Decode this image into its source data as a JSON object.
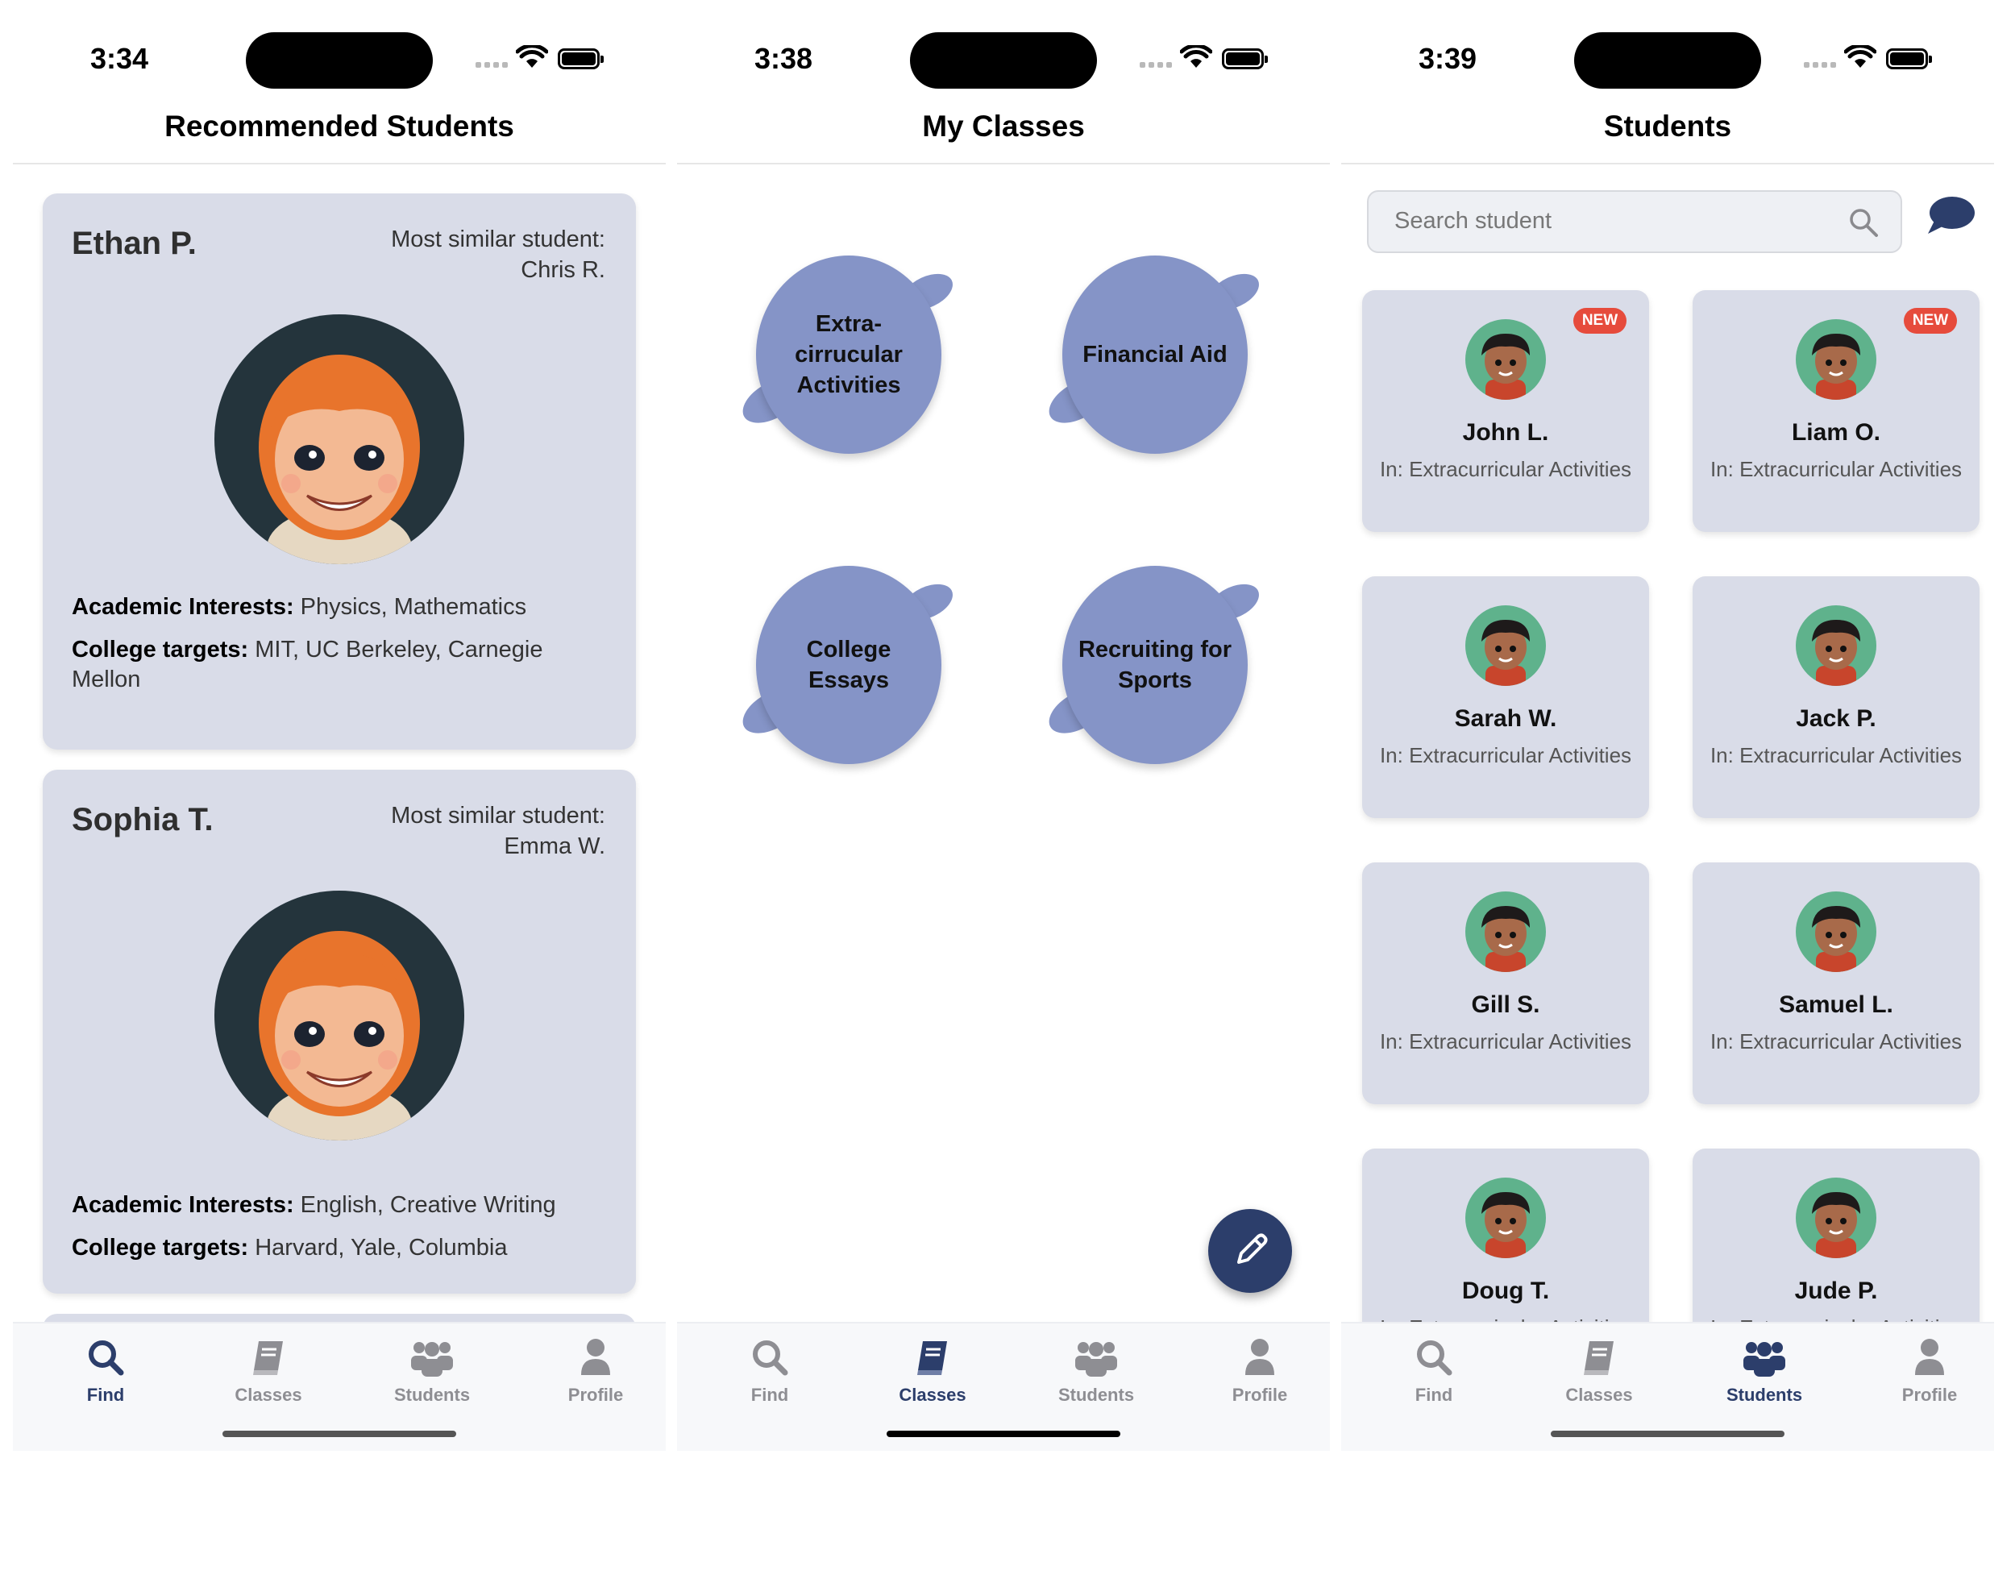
{
  "screens": {
    "find": {
      "time": "3:34",
      "title": "Recommended Students",
      "cards": [
        {
          "name": "Ethan P.",
          "similar_label": "Most similar student:",
          "similar_name": "Chris R.",
          "interests_label": "Academic Interests:",
          "interests": " Physics, Mathematics",
          "targets_label": "College targets:",
          "targets": " MIT, UC Berkeley, Carnegie Mellon"
        },
        {
          "name": "Sophia T.",
          "similar_label": "Most similar student:",
          "similar_name": "Emma W.",
          "interests_label": "Academic Interests:",
          "interests": " English, Creative Writing",
          "targets_label": "College targets:",
          "targets": " Harvard, Yale, Columbia"
        }
      ]
    },
    "classes": {
      "time": "3:38",
      "title": "My Classes",
      "bubbles": [
        "Extra-cirrucular Activities",
        "Financial Aid",
        "College Essays",
        "Recruiting for Sports"
      ]
    },
    "students": {
      "time": "3:39",
      "title": "Students",
      "search_placeholder": "Search student",
      "badge": "NEW",
      "cards": [
        {
          "name": "John L.",
          "class": "In: Extracurricular Activities",
          "is_new": true
        },
        {
          "name": "Liam O.",
          "class": "In: Extracurricular Activities",
          "is_new": true
        },
        {
          "name": "Sarah W.",
          "class": "In: Extracurricular Activities",
          "is_new": false
        },
        {
          "name": "Jack P.",
          "class": "In: Extracurricular Activities",
          "is_new": false
        },
        {
          "name": "Gill S.",
          "class": "In: Extracurricular Activities",
          "is_new": false
        },
        {
          "name": "Samuel L.",
          "class": "In: Extracurricular Activities",
          "is_new": false
        },
        {
          "name": "Doug T.",
          "class": "In: Extracurricular Activities",
          "is_new": false
        },
        {
          "name": "Jude P.",
          "class": "In: Extracurricular Activities",
          "is_new": false
        }
      ]
    }
  },
  "tabs": [
    "Find",
    "Classes",
    "Students",
    "Profile"
  ],
  "colors": {
    "accent": "#2c3e6b",
    "card": "#d9dce8",
    "bubble": "#8594c7",
    "badge": "#e64b3c",
    "inactive": "#8e8e93"
  }
}
